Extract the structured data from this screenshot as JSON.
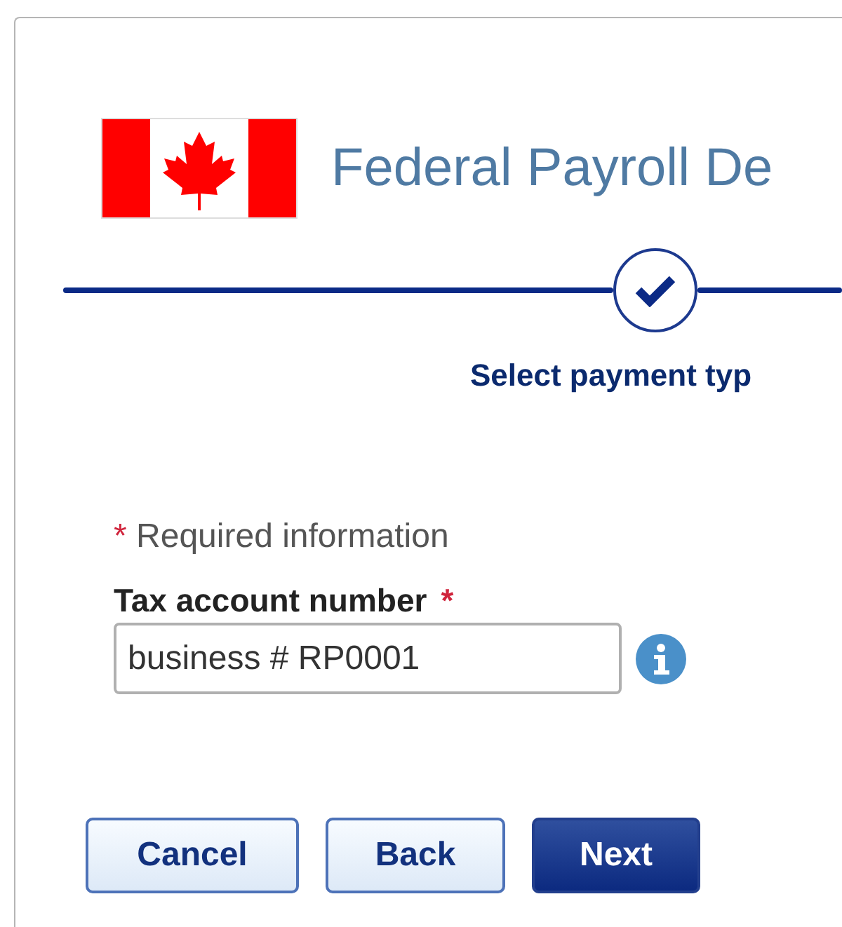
{
  "header": {
    "title": "Federal Payroll De"
  },
  "progress": {
    "step": {
      "label": "Select payment typ",
      "completed": true
    }
  },
  "form": {
    "required_note": {
      "marker": "*",
      "text": "Required information"
    },
    "field": {
      "label": "Tax account number",
      "required_marker": "*",
      "value": "business # RP0001"
    }
  },
  "buttons": [
    {
      "label": "Cancel",
      "kind": "secondary"
    },
    {
      "label": "Back",
      "kind": "secondary"
    },
    {
      "label": "Next",
      "kind": "primary"
    }
  ]
}
